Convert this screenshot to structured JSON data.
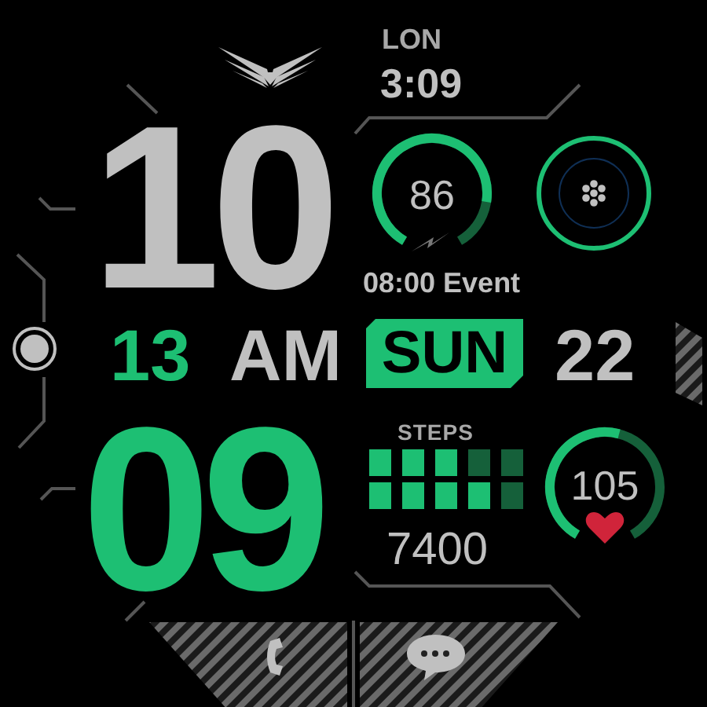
{
  "world_clock": {
    "city": "LON",
    "time": "3:09"
  },
  "time": {
    "hour": "10",
    "minute": "09",
    "second": "13",
    "meridiem": "AM"
  },
  "battery": {
    "value": "86"
  },
  "event": "08:00 Event",
  "date": {
    "weekday": "SUN",
    "day": "22"
  },
  "steps": {
    "label": "STEPS",
    "value": "7400"
  },
  "heart_rate": {
    "value": "105"
  },
  "shortcuts": [
    {
      "kind": "phone"
    },
    {
      "kind": "message"
    }
  ]
}
